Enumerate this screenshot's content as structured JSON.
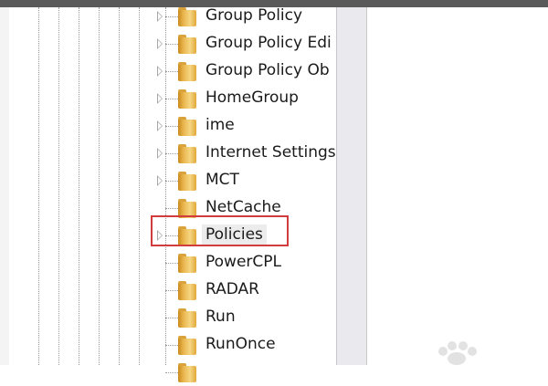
{
  "registry_tree": {
    "items": [
      {
        "label": "Group Policy",
        "has_children": true,
        "selected": false
      },
      {
        "label": "Group Policy Edi",
        "has_children": true,
        "selected": false
      },
      {
        "label": "Group Policy Ob",
        "has_children": true,
        "selected": false
      },
      {
        "label": "HomeGroup",
        "has_children": true,
        "selected": false
      },
      {
        "label": "ime",
        "has_children": true,
        "selected": false
      },
      {
        "label": "Internet Settings",
        "has_children": true,
        "selected": false
      },
      {
        "label": "MCT",
        "has_children": true,
        "selected": false
      },
      {
        "label": "NetCache",
        "has_children": false,
        "selected": false
      },
      {
        "label": "Policies",
        "has_children": true,
        "selected": true
      },
      {
        "label": "PowerCPL",
        "has_children": false,
        "selected": false
      },
      {
        "label": "RADAR",
        "has_children": false,
        "selected": false
      },
      {
        "label": "Run",
        "has_children": false,
        "selected": false
      },
      {
        "label": "RunOnce",
        "has_children": false,
        "selected": false
      },
      {
        "label": "",
        "has_children": false,
        "selected": false
      }
    ]
  },
  "icons": {
    "folder": "folder-icon",
    "expander": "expand-arrow-icon"
  },
  "colors": {
    "highlight_border": "#d23c3c",
    "folder": "#e9b64e",
    "selection_background": "#ececec"
  }
}
